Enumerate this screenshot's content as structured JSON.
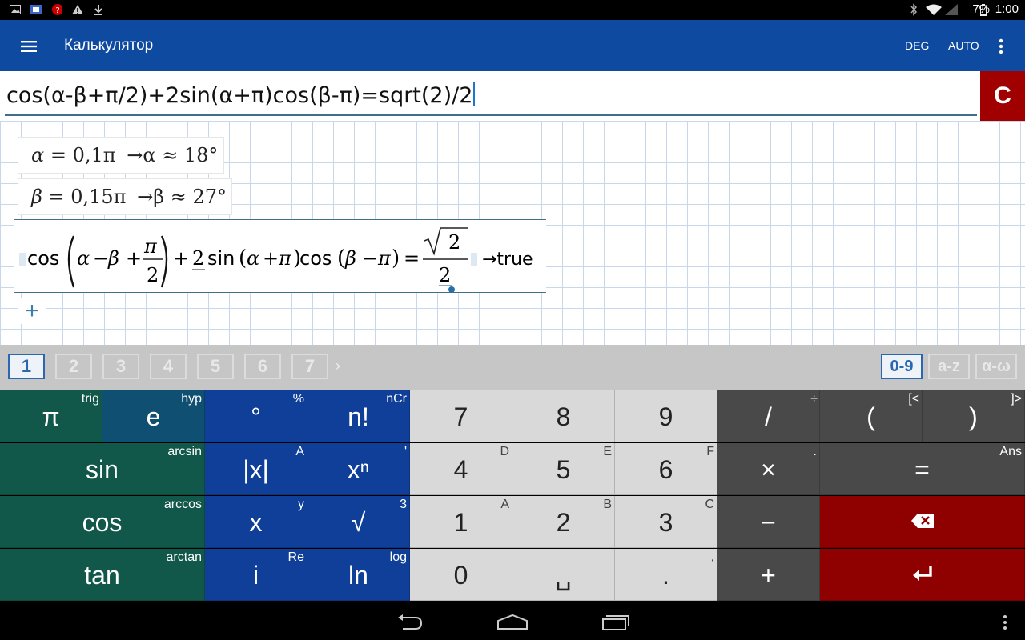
{
  "status_bar": {
    "battery": "7%",
    "time": "1:00",
    "icons": [
      "gallery-icon",
      "app-icon",
      "alert-circle-icon",
      "warning-icon",
      "download-icon",
      "bluetooth-icon",
      "wifi-icon",
      "signal-icon",
      "battery-icon"
    ]
  },
  "action_bar": {
    "title": "Калькулятор",
    "deg": "DEG",
    "auto": "AUTO"
  },
  "input": {
    "expression": "cos(α-β+π/2)+2sin(α+π)cos(β-π)=sqrt(2)/2",
    "clear": "C"
  },
  "worksheet": {
    "cell1": {
      "var": "α",
      "eq": "=",
      "value": "0,1π",
      "result": "→α ≈ 18°"
    },
    "cell2": {
      "var": "β",
      "eq": "=",
      "value": "0,15π",
      "result": "→β ≈ 27°"
    },
    "cell3": {
      "cos1": "cos",
      "alpha": "α",
      "minus": "−",
      "beta": "β",
      "plus": "+",
      "pi": "π",
      "two": "2",
      "plus2": "+",
      "coef": "2",
      "sin": "sin",
      "alpha2": "α",
      "plus3": "+",
      "pi2": "π",
      "cos2": "cos",
      "beta2": "β",
      "minus2": "−",
      "pi3": "π",
      "eq": "=",
      "sqrt_arg": "2",
      "den": "2",
      "result": "→true"
    },
    "add": "+"
  },
  "keyboard_tabs": {
    "numbers": [
      "1",
      "2",
      "3",
      "4",
      "5",
      "6",
      "7"
    ],
    "more": "›",
    "modes": [
      "0-9",
      "a-z",
      "α-ω"
    ],
    "active_number": "1",
    "active_mode": "0-9"
  },
  "keys": {
    "r1": [
      {
        "main": "π",
        "sec": "trig"
      },
      {
        "main": "e",
        "sec": "hyp"
      },
      {
        "main": "°",
        "sec": "%"
      },
      {
        "main": "n!",
        "sec": "nCr"
      },
      {
        "main": "7",
        "sec": ""
      },
      {
        "main": "8",
        "sec": ""
      },
      {
        "main": "9",
        "sec": ""
      },
      {
        "main": "/",
        "sec": "÷"
      },
      {
        "main": "(",
        "sec": "[<"
      },
      {
        "main": ")",
        "sec": "]>"
      }
    ],
    "r2": [
      {
        "main": "sin",
        "sec": "arcsin"
      },
      {
        "main": "|x|",
        "sec": "A"
      },
      {
        "main": "xⁿ",
        "sec": "'"
      },
      {
        "main": "4",
        "sec": "D"
      },
      {
        "main": "5",
        "sec": "E"
      },
      {
        "main": "6",
        "sec": "F"
      },
      {
        "main": "×",
        "sec": "."
      },
      {
        "main": "=",
        "sec": "Ans"
      }
    ],
    "r3": [
      {
        "main": "cos",
        "sec": "arccos"
      },
      {
        "main": "x",
        "sec": "y"
      },
      {
        "main": "√",
        "sec": "3"
      },
      {
        "main": "1",
        "sec": "A"
      },
      {
        "main": "2",
        "sec": "B"
      },
      {
        "main": "3",
        "sec": "C"
      },
      {
        "main": "−",
        "sec": ""
      },
      {
        "main": "⌫",
        "sec": ""
      }
    ],
    "r4": [
      {
        "main": "tan",
        "sec": "arctan"
      },
      {
        "main": "i",
        "sec": "Re"
      },
      {
        "main": "ln",
        "sec": "log"
      },
      {
        "main": "0",
        "sec": ""
      },
      {
        "main": "␣",
        "sec": ""
      },
      {
        "main": ".",
        "sec": ","
      },
      {
        "main": "+",
        "sec": ""
      },
      {
        "main": "↵",
        "sec": ""
      }
    ]
  },
  "colors": {
    "action_bar": "#0f4aa1",
    "clear_button": "#a00000",
    "green_keys": "#11584a",
    "blue_keys": "#0f3f98",
    "gray_keys": "#d9d9d9",
    "dark_keys": "#494949",
    "red_keys": "#8f0000"
  }
}
